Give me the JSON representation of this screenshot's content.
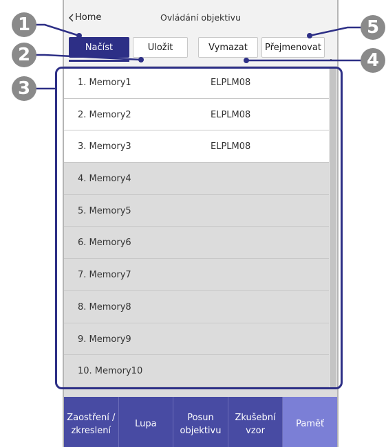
{
  "header": {
    "back_label": "Home",
    "title": "Ovládání objektivu"
  },
  "tabs": [
    {
      "label": "Načíst",
      "active": true
    },
    {
      "label": "Uložit",
      "active": false
    },
    {
      "label": "Vymazat",
      "active": false
    },
    {
      "label": "Přejmenovat",
      "active": false
    }
  ],
  "memories": [
    {
      "name": "1. Memory1",
      "model": "ELPLM08"
    },
    {
      "name": "2. Memory2",
      "model": "ELPLM08"
    },
    {
      "name": "3. Memory3",
      "model": "ELPLM08"
    },
    {
      "name": "4. Memory4",
      "model": ""
    },
    {
      "name": "5. Memory5",
      "model": ""
    },
    {
      "name": "6. Memory6",
      "model": ""
    },
    {
      "name": "7. Memory7",
      "model": ""
    },
    {
      "name": "8. Memory8",
      "model": ""
    },
    {
      "name": "9. Memory9",
      "model": ""
    },
    {
      "name": "10. Memory10",
      "model": ""
    }
  ],
  "bottom_nav": [
    {
      "label": "Zaostření /\nzkreslení",
      "active": false
    },
    {
      "label": "Lupa",
      "active": false
    },
    {
      "label": "Posun\nobjektivu",
      "active": false
    },
    {
      "label": "Zkušební\nvzor",
      "active": false
    },
    {
      "label": "Paměť",
      "active": true
    }
  ],
  "callouts": [
    "1",
    "2",
    "3",
    "4",
    "5"
  ],
  "colors": {
    "accent": "#2d2f86",
    "nav_bg": "#484ba3",
    "nav_active": "#7b7fd6",
    "callout": "#8a8a8a"
  }
}
